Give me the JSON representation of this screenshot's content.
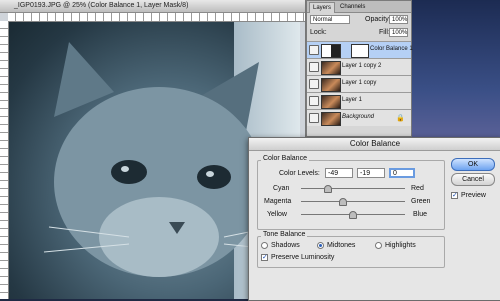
{
  "document": {
    "title": "_IGP0193.JPG @ 25% (Color Balance 1, Layer Mask/8)"
  },
  "layers_panel": {
    "tabs": [
      "Layers",
      "Channels"
    ],
    "blend_mode": "Normal",
    "opacity_label": "Opacity:",
    "opacity_value": "100%",
    "lock_label": "Lock:",
    "fill_label": "Fill:",
    "fill_value": "100%",
    "layers": [
      {
        "name": "Color Balance 1",
        "type": "adjustment"
      },
      {
        "name": "Layer 1 copy 2",
        "type": "pixel"
      },
      {
        "name": "Layer 1 copy",
        "type": "pixel"
      },
      {
        "name": "Layer 1",
        "type": "pixel"
      },
      {
        "name": "Background",
        "type": "pixel",
        "locked": true
      }
    ]
  },
  "color_balance_dialog": {
    "title": "Color Balance",
    "section_color_balance": "Color Balance",
    "levels_label": "Color Levels:",
    "levels": [
      "-49",
      "-19",
      "0"
    ],
    "sliders": [
      {
        "left": "Cyan",
        "right": "Red",
        "value": -49
      },
      {
        "left": "Magenta",
        "right": "Green",
        "value": -19
      },
      {
        "left": "Yellow",
        "right": "Blue",
        "value": 0
      }
    ],
    "section_tone_balance": "Tone Balance",
    "tone_options": [
      "Shadows",
      "Midtones",
      "Highlights"
    ],
    "tone_selected": "Midtones",
    "preserve_luminosity": "Preserve Luminosity",
    "ok": "OK",
    "cancel": "Cancel",
    "preview": "Preview"
  }
}
